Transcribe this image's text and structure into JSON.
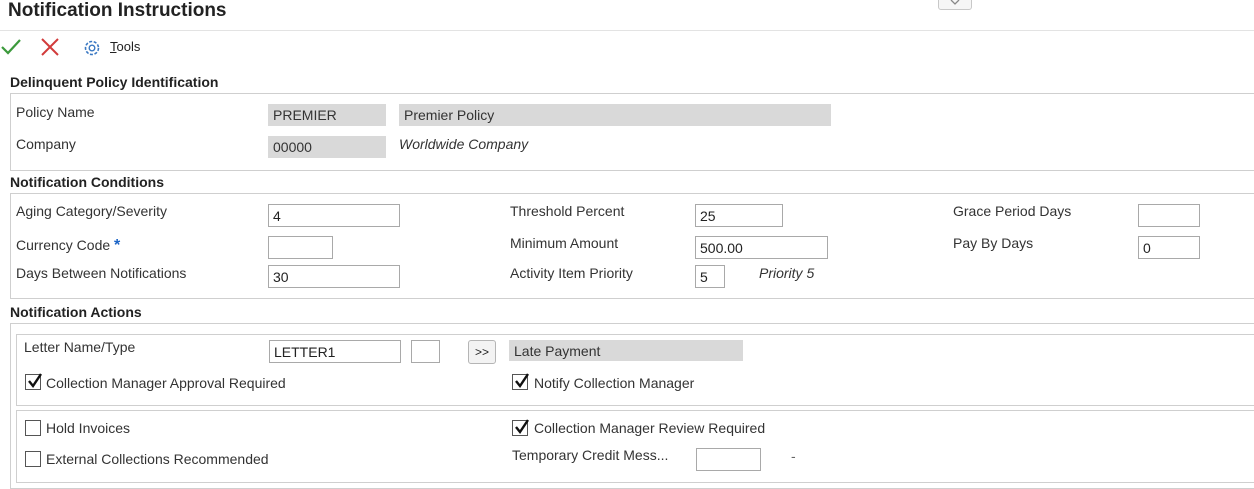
{
  "window": {
    "title": "Notification Instructions"
  },
  "toolbar": {
    "tools_label": "Tools",
    "tools_mnemonic": "T",
    "tools_rest": "ools"
  },
  "identification": {
    "header": "Delinquent Policy Identification",
    "policy_name_label": "Policy Name",
    "policy_name_value": "PREMIER",
    "policy_name_desc": "Premier Policy",
    "company_label": "Company",
    "company_value": "00000",
    "company_desc": "Worldwide Company"
  },
  "conditions": {
    "header": "Notification Conditions",
    "aging_label": "Aging Category/Severity",
    "aging_value": "4",
    "currency_label": "Currency Code",
    "currency_required": "*",
    "currency_value": "",
    "days_between_label": "Days Between Notifications",
    "days_between_value": "30",
    "threshold_label": "Threshold Percent",
    "threshold_value": "25",
    "min_amount_label": "Minimum Amount",
    "min_amount_value": "500.00",
    "priority_label": "Activity Item Priority",
    "priority_value": "5",
    "priority_desc": "Priority 5",
    "grace_label": "Grace Period Days",
    "grace_value": "",
    "pay_by_label": "Pay By Days",
    "pay_by_value": "0"
  },
  "actions": {
    "header": "Notification Actions",
    "letter_label": "Letter Name/Type",
    "letter_value": "LETTER1",
    "letter_type_value": "",
    "search_button": ">>",
    "letter_desc": "Late Payment",
    "approval_label": "Collection Manager Approval Required",
    "approval_checked": true,
    "notify_label": "Notify Collection Manager",
    "notify_checked": true,
    "hold_label": "Hold Invoices",
    "hold_checked": false,
    "review_label": "Collection Manager Review Required",
    "review_checked": true,
    "external_label": "External Collections Recommended",
    "external_checked": false,
    "temp_credit_label": "Temporary Credit Mess...",
    "temp_credit_value": "",
    "temp_credit_dash": "-"
  }
}
